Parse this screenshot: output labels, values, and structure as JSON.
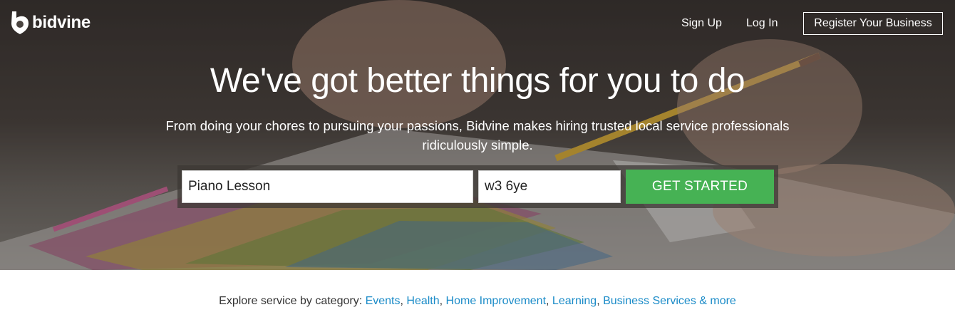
{
  "brand": {
    "name": "bidvine"
  },
  "nav": {
    "sign_up": "Sign Up",
    "log_in": "Log In",
    "register": "Register Your Business"
  },
  "hero": {
    "headline": "We've got better things for you to do",
    "subline": "From doing your chores to pursuing your passions, Bidvine makes hiring trusted local service professionals ridiculously simple."
  },
  "search": {
    "service_value": "Piano Lesson",
    "location_value": "w3 6ye",
    "button_label": "GET STARTED"
  },
  "explore": {
    "prefix": "Explore service by category: ",
    "categories": [
      "Events",
      "Health",
      "Home Improvement",
      "Learning",
      "Business Services & more"
    ]
  },
  "colors": {
    "accent_green": "#46b254",
    "link_blue": "#1a8bc8"
  }
}
